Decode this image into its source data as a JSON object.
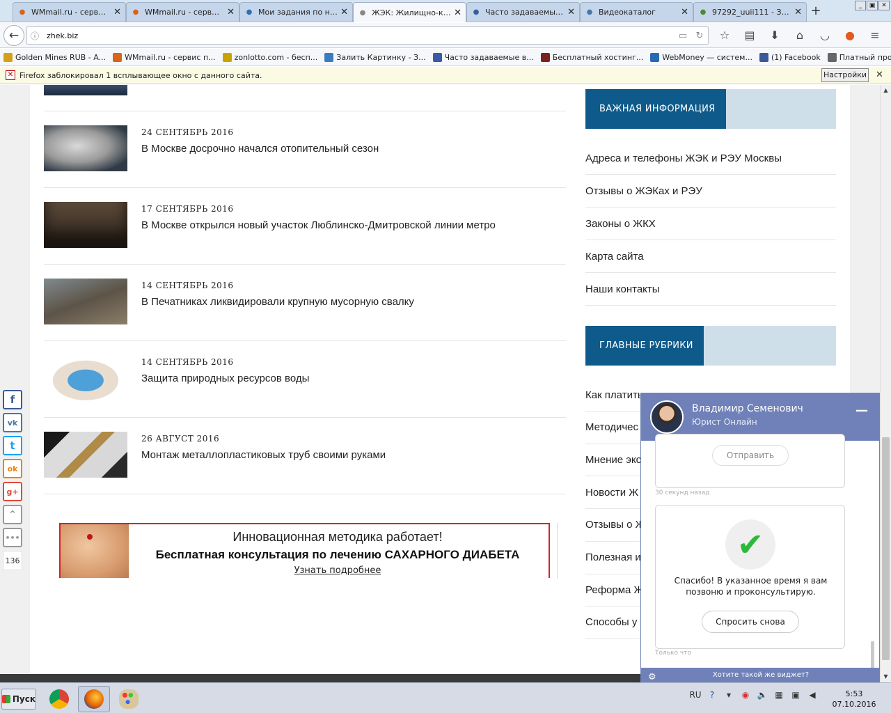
{
  "browser": {
    "tabs": [
      {
        "label": "WMmail.ru - сервис...",
        "icon": "at-icon",
        "color": "#d8631a",
        "active": false
      },
      {
        "label": "WMmail.ru - сервис...",
        "icon": "at-icon",
        "color": "#d8631a",
        "active": false
      },
      {
        "label": "Мои задания по на...",
        "icon": "target-icon",
        "color": "#2c6fb5",
        "active": false
      },
      {
        "label": "ЖЭК: Жилищно-ко...",
        "icon": "speaker-icon",
        "color": "#888888",
        "active": true
      },
      {
        "label": "Часто задаваемые...",
        "icon": "page-icon",
        "color": "#3b5aa4",
        "active": false
      },
      {
        "label": "Видеокаталог",
        "icon": "vk-icon",
        "color": "#4a76a8",
        "active": false
      },
      {
        "label": "97292_uuii111 - За...",
        "icon": "image-icon",
        "color": "#4a8a3a",
        "active": false
      }
    ],
    "url": "zhek.biz",
    "bookmarks": [
      {
        "label": "Golden Mines RUB - A...",
        "color": "#d4a017"
      },
      {
        "label": "WMmail.ru - сервис п...",
        "color": "#d8631a"
      },
      {
        "label": "zonlotto.com - бесп...",
        "color": "#c9a200"
      },
      {
        "label": "Залить Картинку - З...",
        "color": "#3b7bbf"
      },
      {
        "label": "Часто задаваемые в...",
        "color": "#3b5aa4"
      },
      {
        "label": "Бесплатный хостинг...",
        "color": "#7a2222"
      },
      {
        "label": "WebMoney — систем...",
        "color": "#2769b5"
      },
      {
        "label": "(1) Facebook",
        "color": "#3b5998"
      },
      {
        "label": "Платный просмотр с...",
        "color": "#666666"
      }
    ],
    "notification": {
      "text": "Firefox заблокировал 1 всплывающее окно с данного сайта.",
      "button": "Настройки"
    }
  },
  "news": [
    {
      "date": "24 СЕНТЯБРЬ 2016",
      "title": "В Москве досрочно начался отопительный сезон"
    },
    {
      "date": "17 СЕНТЯБРЬ 2016",
      "title": "В Москве открылся новый участок Люблинско-Дмитровской линии метро"
    },
    {
      "date": "14 СЕНТЯБРЬ 2016",
      "title": "В Печатниках ликвидировали крупную мусорную свалку"
    },
    {
      "date": "14 СЕНТЯБРЬ 2016",
      "title": "Защита природных ресурсов воды"
    },
    {
      "date": "26 АВГУСТ 2016",
      "title": "Монтаж металлопластиковых труб своими руками"
    }
  ],
  "ad": {
    "line1": "Инновационная методика работает!",
    "line2": "Бесплатная консультация по лечению САХАРНОГО ДИАБЕТА",
    "link": "Узнать подробнее"
  },
  "sidebar": {
    "important_title": "ВАЖНАЯ ИНФОРМАЦИЯ",
    "important_items": [
      "Адреса и телефоны ЖЭК и РЭУ Москвы",
      "Отзывы о ЖЭКах и РЭУ",
      "Законы о ЖКХ",
      "Карта сайта",
      "Наши контакты"
    ],
    "rubrics_title": "ГЛАВНЫЕ РУБРИКИ",
    "rubric_items": [
      "Как платить",
      "Методичес",
      "Мнение экс",
      "Новости Ж",
      "Отзывы о Ж",
      "Полезная и",
      "Реформа Ж",
      "Способы у"
    ]
  },
  "social": {
    "buttons": [
      {
        "name": "facebook-icon",
        "glyph": "f",
        "color": "#3b5998"
      },
      {
        "name": "vk-icon",
        "glyph": "vk",
        "color": "#4a76a8"
      },
      {
        "name": "twitter-icon",
        "glyph": "t",
        "color": "#1da1f2"
      },
      {
        "name": "odnoklassniki-icon",
        "glyph": "ok",
        "color": "#ee8208"
      },
      {
        "name": "googleplus-icon",
        "glyph": "g+",
        "color": "#dd4b39"
      },
      {
        "name": "collapse-icon",
        "glyph": "⌃",
        "color": "#999999"
      },
      {
        "name": "more-icon",
        "glyph": "•••",
        "color": "#999999"
      }
    ],
    "count": "136"
  },
  "chat": {
    "name": "Владимир Семенович",
    "role": "Юрист Онлайн",
    "send_button": "Отправить",
    "time1": "30 секунд назад",
    "message": "Спасибо! В указанное время я вам позвоню и проконсультирую.",
    "ask_again_button": "Спросить снова",
    "time2": "Только что",
    "footer": "Хотите такой же виджет?"
  },
  "taskbar": {
    "start": "Пуск",
    "lang": "RU",
    "time": "5:53",
    "date": "07.10.2016"
  }
}
